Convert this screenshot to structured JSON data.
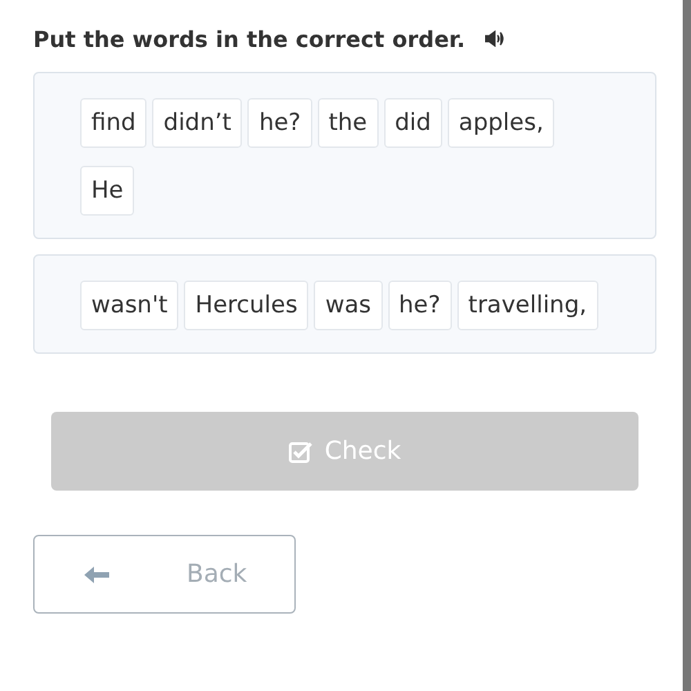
{
  "instruction": "Put the words in the correct order.",
  "groups": [
    {
      "words": [
        "find",
        "didn’t",
        "he?",
        "the",
        "did",
        "apples,",
        "He"
      ]
    },
    {
      "words": [
        "wasn't",
        "Hercules",
        "was",
        "he?",
        "travelling,"
      ]
    }
  ],
  "check_button": {
    "label": "Check",
    "disabled": true
  },
  "back_button": {
    "label": "Back"
  }
}
